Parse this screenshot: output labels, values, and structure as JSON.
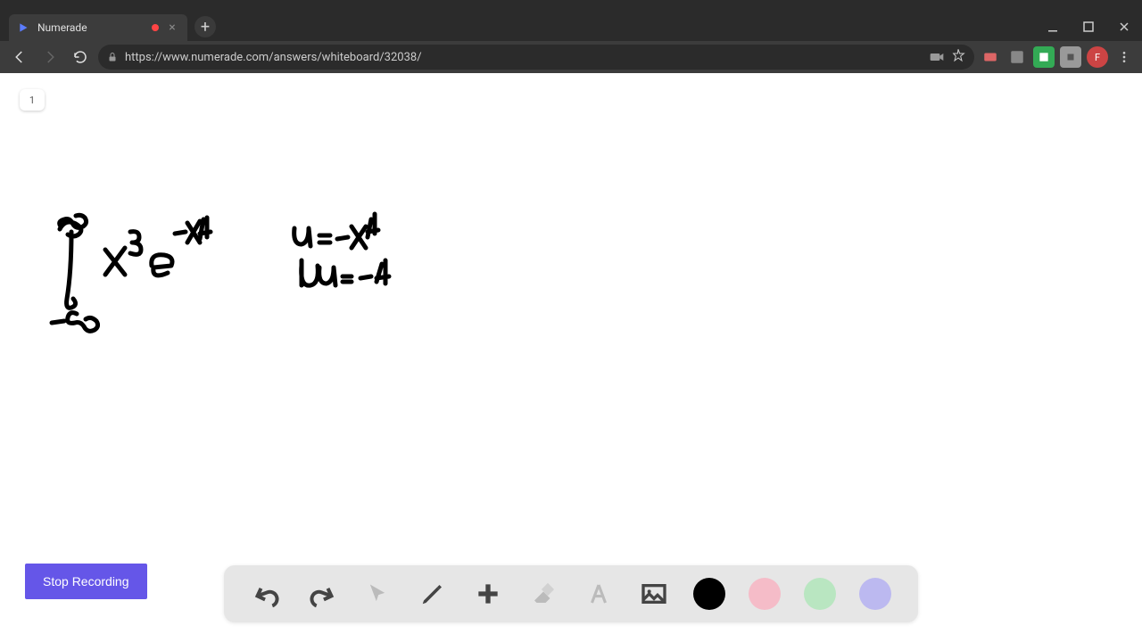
{
  "browser": {
    "tab_title": "Numerade",
    "url": "https://www.numerade.com/answers/whiteboard/32038/",
    "profile_letter": "F"
  },
  "page": {
    "page_number": "1"
  },
  "whiteboard": {
    "handwriting_description": "Integral from -∞ to ∞ of x³ e^(-x⁴), with u-substitution notes: u = -x⁴ and du = -4"
  },
  "controls": {
    "stop_recording_label": "Stop Recording"
  },
  "toolbar": {
    "tools": [
      "undo",
      "redo",
      "pointer",
      "pen",
      "add",
      "eraser",
      "text",
      "image"
    ],
    "colors": [
      "#000000",
      "#f5bcc8",
      "#b9e6c1",
      "#bcb9f0"
    ]
  }
}
